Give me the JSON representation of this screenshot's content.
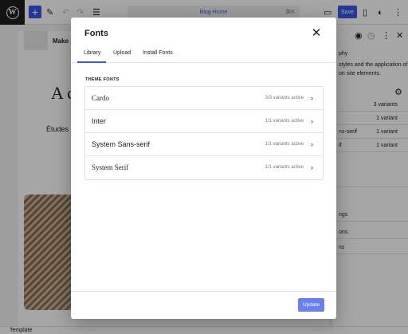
{
  "colors": {
    "accent": "#3858e9",
    "chrome_dark": "#1e1e1e",
    "border": "#e0e0e0",
    "muted_text": "#757575"
  },
  "topbar": {
    "logo": "wordpress-logo",
    "add_icon": "plus-icon",
    "doc_title": "Blog Home",
    "doc_shortcut": "⌘K",
    "save_label": "Save"
  },
  "canvas": {
    "site_title": "Make",
    "heading": "A c",
    "subtext": "Études i"
  },
  "sidebar": {
    "intro_1": "phy",
    "intro_2": "styles and the application of",
    "intro_3": "on site elements.",
    "rows": [
      {
        "left": "",
        "right": "3 variants"
      },
      {
        "left": "",
        "right": "1 variant"
      },
      {
        "left": "ns-serif",
        "right": "1 variant"
      },
      {
        "left": "if",
        "right": "1 variant"
      }
    ],
    "links": [
      "",
      "ngs",
      "ons",
      "ns"
    ]
  },
  "footer": {
    "label": "Template"
  },
  "modal": {
    "title": "Fonts",
    "close_icon": "close-icon",
    "tabs": [
      "Library",
      "Upload",
      "Install Fonts"
    ],
    "active_tab": "Library",
    "section_label": "THEME FONTS",
    "fonts": [
      {
        "name": "Cardo",
        "variants": "3/3 variants active"
      },
      {
        "name": "Inter",
        "variants": "1/1 variants active"
      },
      {
        "name": "System Sans-serif",
        "variants": "1/1 variants active"
      },
      {
        "name": "System Serif",
        "variants": "1/1 variants active"
      }
    ],
    "update_label": "Update"
  }
}
